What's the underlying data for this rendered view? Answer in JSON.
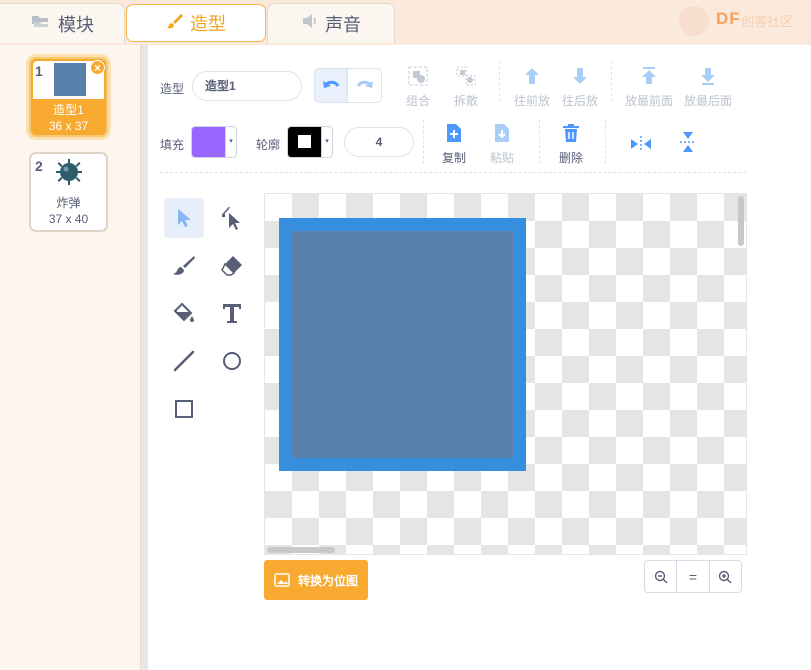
{
  "tabs": [
    {
      "label": "模块",
      "icon": "code-blocks-icon"
    },
    {
      "label": "造型",
      "icon": "paintbrush-icon"
    },
    {
      "label": "声音",
      "icon": "speaker-icon"
    }
  ],
  "brand": {
    "logo": "DF",
    "text": "创客社区"
  },
  "sprites": [
    {
      "number": "1",
      "name": "造型1",
      "size": "36 x 37",
      "thumb_color": "#597fab"
    },
    {
      "number": "2",
      "name": "炸弹",
      "size": "37 x 40",
      "thumb_icon": "sea-mine-icon"
    }
  ],
  "toolbar": {
    "costume_label": "造型",
    "costume_name": "造型1",
    "group": "组合",
    "ungroup": "拆散",
    "forward": "往前放",
    "backward": "往后放",
    "front": "放最前面",
    "back": "放最后面",
    "fill_label": "填充",
    "fill_color": "#9966ff",
    "outline_label": "轮廓",
    "outline_color": "#000000",
    "outline_width": "4",
    "copy": "复制",
    "paste": "粘贴",
    "delete": "删除"
  },
  "tools": [
    "select-icon",
    "reshape-icon",
    "brush-icon",
    "eraser-icon",
    "fill-icon",
    "text-icon",
    "line-icon",
    "circle-icon",
    "rectangle-icon"
  ],
  "canvas": {
    "shape_fill": "#597fab",
    "shape_outline": "#368fde"
  },
  "bottom": {
    "convert_bitmap": "转换为位图",
    "zoom_out": "zoom-out-icon",
    "zoom_reset": "=",
    "zoom_in": "zoom-in-icon"
  }
}
